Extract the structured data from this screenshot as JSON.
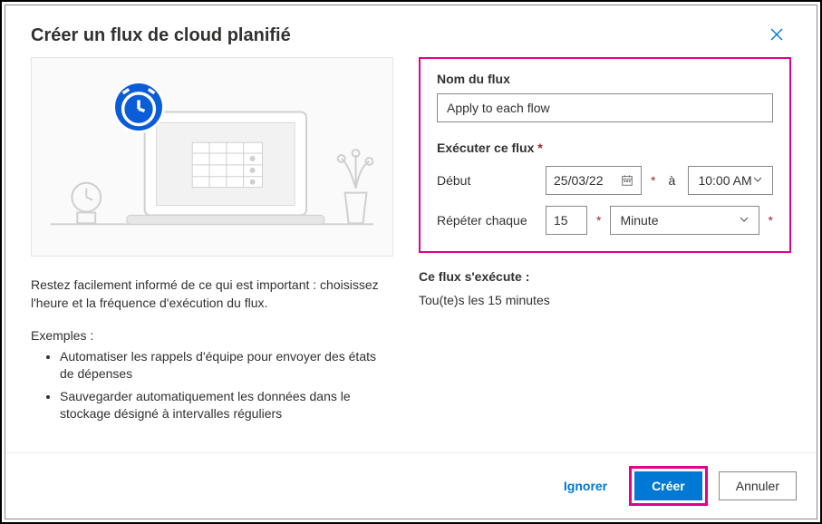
{
  "header": {
    "title": "Créer un flux de cloud planifié"
  },
  "left": {
    "desc": "Restez facilement informé de ce qui est important : choisissez l'heure et la fréquence d'exécution du flux.",
    "examples_h": "Exemples :",
    "ex1": "Automatiser les rappels d'équipe pour envoyer des états de dépenses",
    "ex2": "Sauvegarder automatiquement les données dans le stockage désigné à intervalles réguliers"
  },
  "form": {
    "name_label": "Nom du flux",
    "name_value": "Apply to each flow",
    "run_this_label": "Exécuter ce flux",
    "start_label": "Début",
    "date_value": "25/03/22",
    "at_label": "à",
    "time_value": "10:00 AM",
    "repeat_label": "Répéter chaque",
    "repeat_value": "15",
    "repeat_unit": "Minute"
  },
  "summary": {
    "heading": "Ce flux s'exécute :",
    "value": "Tou(te)s les 15 minutes"
  },
  "footer": {
    "skip": "Ignorer",
    "create": "Créer",
    "cancel": "Annuler"
  }
}
